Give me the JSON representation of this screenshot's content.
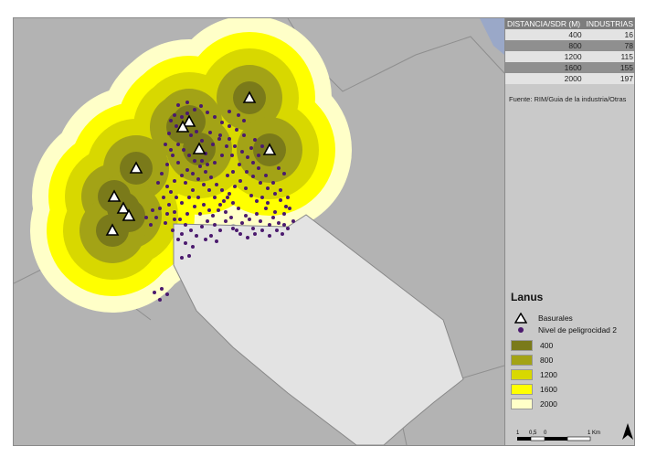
{
  "table": {
    "headers": [
      "DISTANCIA/SDR (M)",
      "INDUSTRIAS"
    ],
    "rows": [
      {
        "distance": "400",
        "count": "16"
      },
      {
        "distance": "800",
        "count": "78"
      },
      {
        "distance": "1200",
        "count": "115"
      },
      {
        "distance": "1600",
        "count": "155"
      },
      {
        "distance": "2000",
        "count": "197"
      }
    ]
  },
  "source": "Fuente: RIM/Guia de la industria/Otras",
  "legend": {
    "title": "Lanus",
    "basurales": "Basurales",
    "industries": "Nivel de peligrocidad 2",
    "bands": [
      {
        "label": "400",
        "color": "#7a7a1a"
      },
      {
        "label": "800",
        "color": "#a3a316"
      },
      {
        "label": "1200",
        "color": "#d8d800"
      },
      {
        "label": "1600",
        "color": "#ffff00"
      },
      {
        "label": "2000",
        "color": "#ffffc8"
      }
    ]
  },
  "scale": {
    "ticks": [
      "1",
      "0,5",
      "0",
      "1 Km"
    ]
  },
  "map": {
    "landfills": [
      [
        258,
        87
      ],
      [
        192,
        113
      ],
      [
        185,
        119
      ],
      [
        203,
        143
      ],
      [
        280,
        144
      ],
      [
        134,
        164
      ],
      [
        110,
        195
      ],
      [
        120,
        208
      ],
      [
        126,
        216
      ],
      [
        108,
        232
      ]
    ],
    "industries": [
      [
        180,
        95
      ],
      [
        190,
        92
      ],
      [
        198,
        100
      ],
      [
        205,
        96
      ],
      [
        212,
        103
      ],
      [
        220,
        108
      ],
      [
        228,
        114
      ],
      [
        236,
        118
      ],
      [
        244,
        122
      ],
      [
        252,
        128
      ],
      [
        264,
        133
      ],
      [
        178,
        118
      ],
      [
        170,
        126
      ],
      [
        194,
        128
      ],
      [
        215,
        125
      ],
      [
        225,
        132
      ],
      [
        233,
        140
      ],
      [
        239,
        150
      ],
      [
        247,
        160
      ],
      [
        255,
        168
      ],
      [
        262,
        173
      ],
      [
        270,
        180
      ],
      [
        278,
        186
      ],
      [
        286,
        192
      ],
      [
        292,
        199
      ],
      [
        298,
        206
      ],
      [
        286,
        212
      ],
      [
        276,
        208
      ],
      [
        266,
        214
      ],
      [
        258,
        220
      ],
      [
        250,
        224
      ],
      [
        244,
        232
      ],
      [
        238,
        218
      ],
      [
        232,
        212
      ],
      [
        226,
        204
      ],
      [
        220,
        196
      ],
      [
        214,
        188
      ],
      [
        208,
        182
      ],
      [
        202,
        176
      ],
      [
        196,
        170
      ],
      [
        190,
        166
      ],
      [
        184,
        172
      ],
      [
        176,
        178
      ],
      [
        168,
        184
      ],
      [
        164,
        196
      ],
      [
        170,
        204
      ],
      [
        176,
        212
      ],
      [
        182,
        220
      ],
      [
        188,
        226
      ],
      [
        194,
        232
      ],
      [
        200,
        238
      ],
      [
        206,
        228
      ],
      [
        212,
        222
      ],
      [
        218,
        216
      ],
      [
        224,
        210
      ],
      [
        230,
        200
      ],
      [
        236,
        192
      ],
      [
        242,
        184
      ],
      [
        248,
        178
      ],
      [
        254,
        186
      ],
      [
        260,
        194
      ],
      [
        266,
        200
      ],
      [
        272,
        196
      ],
      [
        278,
        202
      ],
      [
        284,
        218
      ],
      [
        290,
        224
      ],
      [
        296,
        214
      ],
      [
        302,
        208
      ],
      [
        296,
        226
      ],
      [
        280,
        226
      ],
      [
        270,
        222
      ],
      [
        262,
        230
      ],
      [
        254,
        216
      ],
      [
        246,
        208
      ],
      [
        240,
        202
      ],
      [
        234,
        196
      ],
      [
        228,
        188
      ],
      [
        222,
        182
      ],
      [
        216,
        174
      ],
      [
        210,
        168
      ],
      [
        204,
        162
      ],
      [
        198,
        156
      ],
      [
        192,
        150
      ],
      [
        186,
        144
      ],
      [
        180,
        138
      ],
      [
        174,
        150
      ],
      [
        168,
        160
      ],
      [
        162,
        170
      ],
      [
        158,
        180
      ],
      [
        160,
        208
      ],
      [
        156,
        218
      ],
      [
        166,
        224
      ],
      [
        174,
        232
      ],
      [
        180,
        242
      ],
      [
        188,
        246
      ],
      [
        196,
        250
      ],
      [
        192,
        260
      ],
      [
        184,
        262
      ],
      [
        150,
        226
      ],
      [
        145,
        218
      ],
      [
        152,
        210
      ],
      [
        234,
        172
      ],
      [
        240,
        168
      ],
      [
        256,
        152
      ],
      [
        262,
        158
      ],
      [
        268,
        164
      ],
      [
        290,
        164
      ],
      [
        296,
        170
      ],
      [
        252,
        112
      ],
      [
        246,
        106
      ],
      [
        236,
        102
      ],
      [
        226,
        128
      ],
      [
        218,
        138
      ],
      [
        210,
        148
      ],
      [
        206,
        134
      ],
      [
        200,
        124
      ],
      [
        190,
        104
      ],
      [
        184,
        108
      ],
      [
        176,
        106
      ],
      [
        172,
        112
      ],
      [
        166,
        138
      ],
      [
        172,
        144
      ],
      [
        180,
        158
      ],
      [
        188,
        180
      ],
      [
        196,
        188
      ],
      [
        202,
        196
      ],
      [
        208,
        204
      ],
      [
        214,
        210
      ],
      [
        220,
        226
      ],
      [
        226,
        232
      ],
      [
        232,
        222
      ],
      [
        240,
        230
      ],
      [
        248,
        236
      ],
      [
        256,
        240
      ],
      [
        264,
        236
      ],
      [
        272,
        232
      ],
      [
        280,
        238
      ],
      [
        288,
        232
      ],
      [
        294,
        236
      ],
      [
        300,
        230
      ],
      [
        306,
        222
      ],
      [
        300,
        196
      ],
      [
        292,
        188
      ],
      [
        284,
        180
      ],
      [
        276,
        172
      ],
      [
        268,
        150
      ],
      [
        272,
        140
      ],
      [
        260,
        142
      ],
      [
        250,
        146
      ],
      [
        242,
        140
      ],
      [
        236,
        132
      ],
      [
        228,
        150
      ],
      [
        220,
        158
      ],
      [
        212,
        160
      ],
      [
        206,
        156
      ],
      [
        192,
        196
      ],
      [
        184,
        202
      ],
      [
        178,
        196
      ],
      [
        172,
        190
      ],
      [
        168,
        214
      ],
      [
        176,
        220
      ],
      [
        184,
        236
      ],
      [
        190,
        214
      ],
      [
        198,
        206
      ],
      [
        204,
        214
      ],
      [
        210,
        242
      ],
      [
        216,
        238
      ],
      [
        222,
        244
      ],
      [
        154,
        300
      ],
      [
        162,
        296
      ],
      [
        168,
        302
      ],
      [
        160,
        308
      ]
    ]
  }
}
